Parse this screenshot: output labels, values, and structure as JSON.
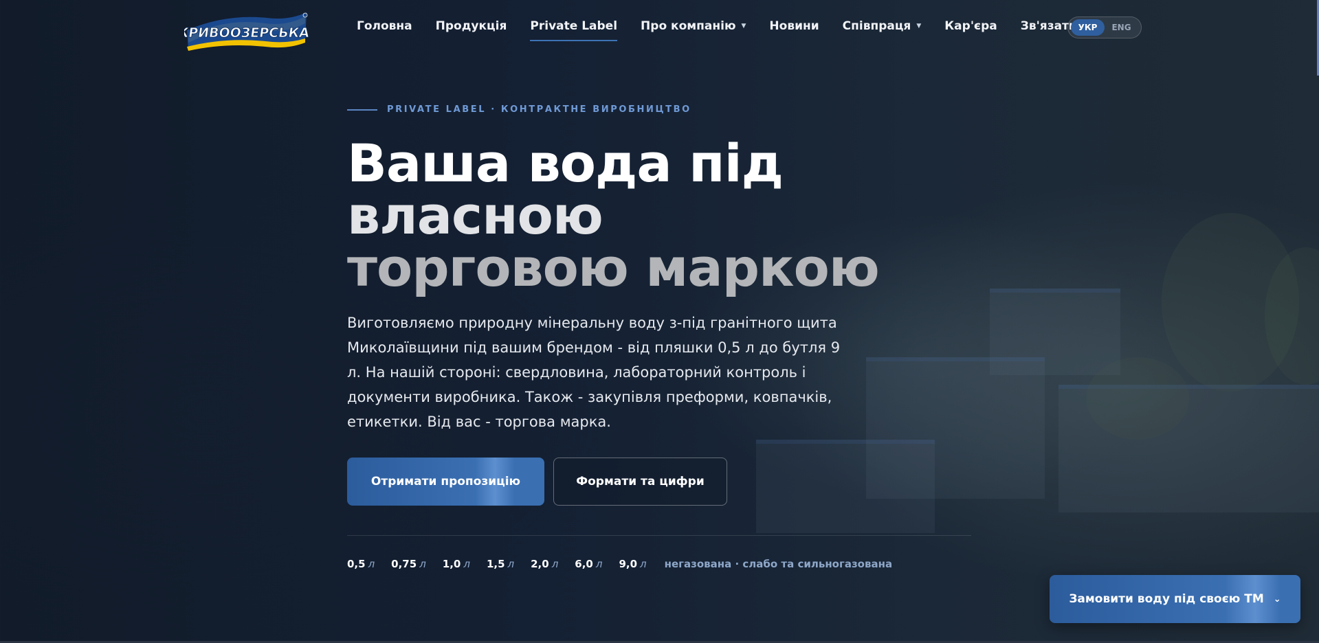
{
  "header": {
    "logo_text": "КРИВООЗЕРСЬКА",
    "nav": [
      {
        "label": "Головна",
        "has_dropdown": false,
        "active": false
      },
      {
        "label": "Продукція",
        "has_dropdown": false,
        "active": false
      },
      {
        "label": "Private Label",
        "has_dropdown": false,
        "active": true
      },
      {
        "label": "Про компанію",
        "has_dropdown": true,
        "active": false
      },
      {
        "label": "Новини",
        "has_dropdown": false,
        "active": false
      },
      {
        "label": "Співпраця",
        "has_dropdown": true,
        "active": false
      },
      {
        "label": "Кар'єра",
        "has_dropdown": false,
        "active": false
      },
      {
        "label": "Зв'язатись",
        "has_dropdown": false,
        "active": false
      }
    ],
    "lang": {
      "active": "УКР",
      "other": "ENG"
    }
  },
  "hero": {
    "eyebrow": "PRIVATE LABEL · КОНТРАКТНЕ ВИРОБНИЦТВО",
    "title_lines": [
      "Ваша вода під",
      "власною",
      "торговою маркою"
    ],
    "lead": "Виготовляємо природну мінеральну воду з-під гранітного щита Миколаївщини під вашим брендом - від пляшки 0,5 л до бутля 9 л. На нашій стороні: свердловина, лабораторний контроль і документи виробника. Також - закупівля преформи, ковпачків, етикетки. Від вас - торгова марка.",
    "primary_button": "Отримати пропозицію",
    "secondary_button": "Формати та цифри",
    "formats": [
      {
        "value": "0,5",
        "unit": "л"
      },
      {
        "value": "0,75",
        "unit": "л"
      },
      {
        "value": "1,0",
        "unit": "л"
      },
      {
        "value": "1,5",
        "unit": "л"
      },
      {
        "value": "2,0",
        "unit": "л"
      },
      {
        "value": "6,0",
        "unit": "л"
      },
      {
        "value": "9,0",
        "unit": "л"
      }
    ],
    "formats_note": "негазована · слабо та сильногазована"
  },
  "order_button": {
    "label": "Замовити воду під своєю ТМ"
  },
  "colors": {
    "accent": "#3a6fb2",
    "background": "#142033",
    "eyebrow": "#6f9ad6",
    "logo_yellow": "#f2c200",
    "logo_blue": "#1d4f9a"
  },
  "icons": {
    "nav_dropdown": "caret-down-icon",
    "order_chevron": "chevron-down-icon"
  }
}
